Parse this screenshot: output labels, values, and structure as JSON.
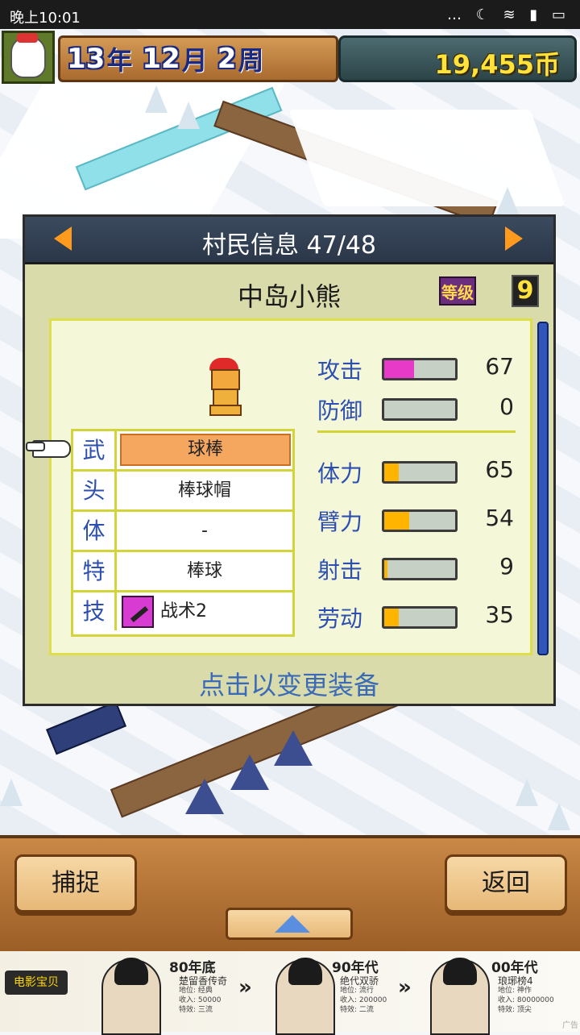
{
  "status_bar": {
    "time": "晚上10:01",
    "icons": "… ☾ ≋ ▮ ▭"
  },
  "header": {
    "year_num": "13",
    "year_unit": "年",
    "month_num": "12",
    "month_unit": "月",
    "week_num": "2",
    "week_unit": "周",
    "coins": "19,455币"
  },
  "dialog": {
    "title": "村民信息 47/48",
    "villager_name": "中岛小熊",
    "level_label": "等级",
    "level_value": "9",
    "equipment": [
      {
        "slot": "武",
        "value": "球棒"
      },
      {
        "slot": "头",
        "value": "棒球帽"
      },
      {
        "slot": "体",
        "value": "-"
      },
      {
        "slot": "特",
        "value": "棒球"
      },
      {
        "slot": "技",
        "value": "战术2"
      }
    ],
    "stats": [
      {
        "label": "攻击",
        "value": "67",
        "fill": 0.42,
        "color": "#e83ac8"
      },
      {
        "label": "防御",
        "value": "0",
        "fill": 0.0,
        "color": "#ffb400"
      },
      {
        "label": "体力",
        "value": "65",
        "fill": 0.2,
        "color": "#ffb400"
      },
      {
        "label": "臂力",
        "value": "54",
        "fill": 0.35,
        "color": "#ffb400"
      },
      {
        "label": "射击",
        "value": "9",
        "fill": 0.04,
        "color": "#ffb400"
      },
      {
        "label": "劳动",
        "value": "35",
        "fill": 0.2,
        "color": "#ffb400"
      }
    ],
    "hint": "点击以变更装备"
  },
  "buttons": {
    "catch": "捕捉",
    "back": "返回"
  },
  "ad": {
    "logo": "电影宝贝",
    "era1": "80年底",
    "sub1": "楚留香传奇",
    "era1_details": [
      "地位: 经典",
      "收入: 50000",
      "特效: 三流"
    ],
    "era2": "90年代",
    "sub2": "绝代双骄",
    "era2_details": [
      "地位: 流行",
      "收入: 200000",
      "特效: 二流"
    ],
    "era3": "00年代",
    "sub3": "琅琊榜4",
    "era3_details": [
      "地位: 神作",
      "收入: 80000000",
      "特效: 顶尖"
    ],
    "tag": "广告"
  }
}
